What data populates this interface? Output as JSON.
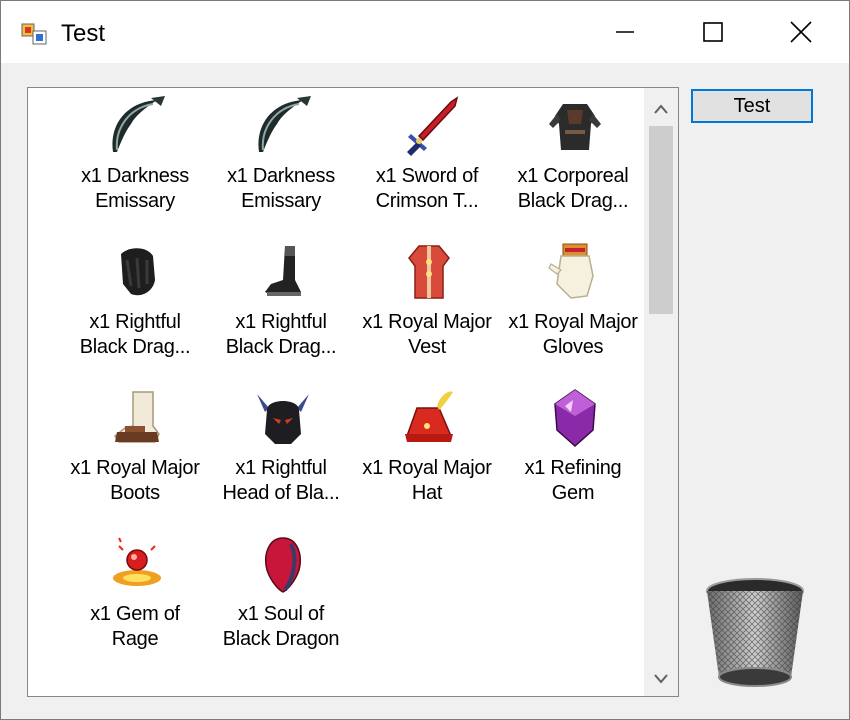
{
  "window": {
    "title": "Test"
  },
  "titlebar": {
    "minimize_icon": "minimize-icon",
    "maximize_icon": "maximize-icon",
    "close_icon": "close-icon"
  },
  "actions": {
    "test_label": "Test"
  },
  "items": [
    {
      "label": "x1 Darkness\nEmissary",
      "icon": "scythe-icon"
    },
    {
      "label": "x1 Darkness\nEmissary",
      "icon": "scythe-icon"
    },
    {
      "label": "x1 Sword of\nCrimson T...",
      "icon": "sword-icon"
    },
    {
      "label": "x1 Corporeal\nBlack Drag...",
      "icon": "armor-icon"
    },
    {
      "label": "x1 Rightful\nBlack Drag...",
      "icon": "gauntlet-icon"
    },
    {
      "label": "x1 Rightful\nBlack Drag...",
      "icon": "boot-icon"
    },
    {
      "label": "x1 Royal Major\nVest",
      "icon": "vest-icon"
    },
    {
      "label": "x1 Royal Major\nGloves",
      "icon": "gloves-icon"
    },
    {
      "label": "x1 Royal Major\nBoots",
      "icon": "boots-icon"
    },
    {
      "label": "x1 Rightful\nHead of Bla...",
      "icon": "helmet-icon"
    },
    {
      "label": "x1 Royal Major\nHat",
      "icon": "hat-icon"
    },
    {
      "label": "x1 Refining\nGem",
      "icon": "gem-icon"
    },
    {
      "label": "x1 Gem of\nRage",
      "icon": "rage-gem-icon"
    },
    {
      "label": "x1 Soul of\nBlack Dragon",
      "icon": "soul-icon"
    }
  ],
  "scrollbar": {
    "position": 0.0
  },
  "recycle_bin": {
    "icon": "recycle-bin-icon"
  }
}
